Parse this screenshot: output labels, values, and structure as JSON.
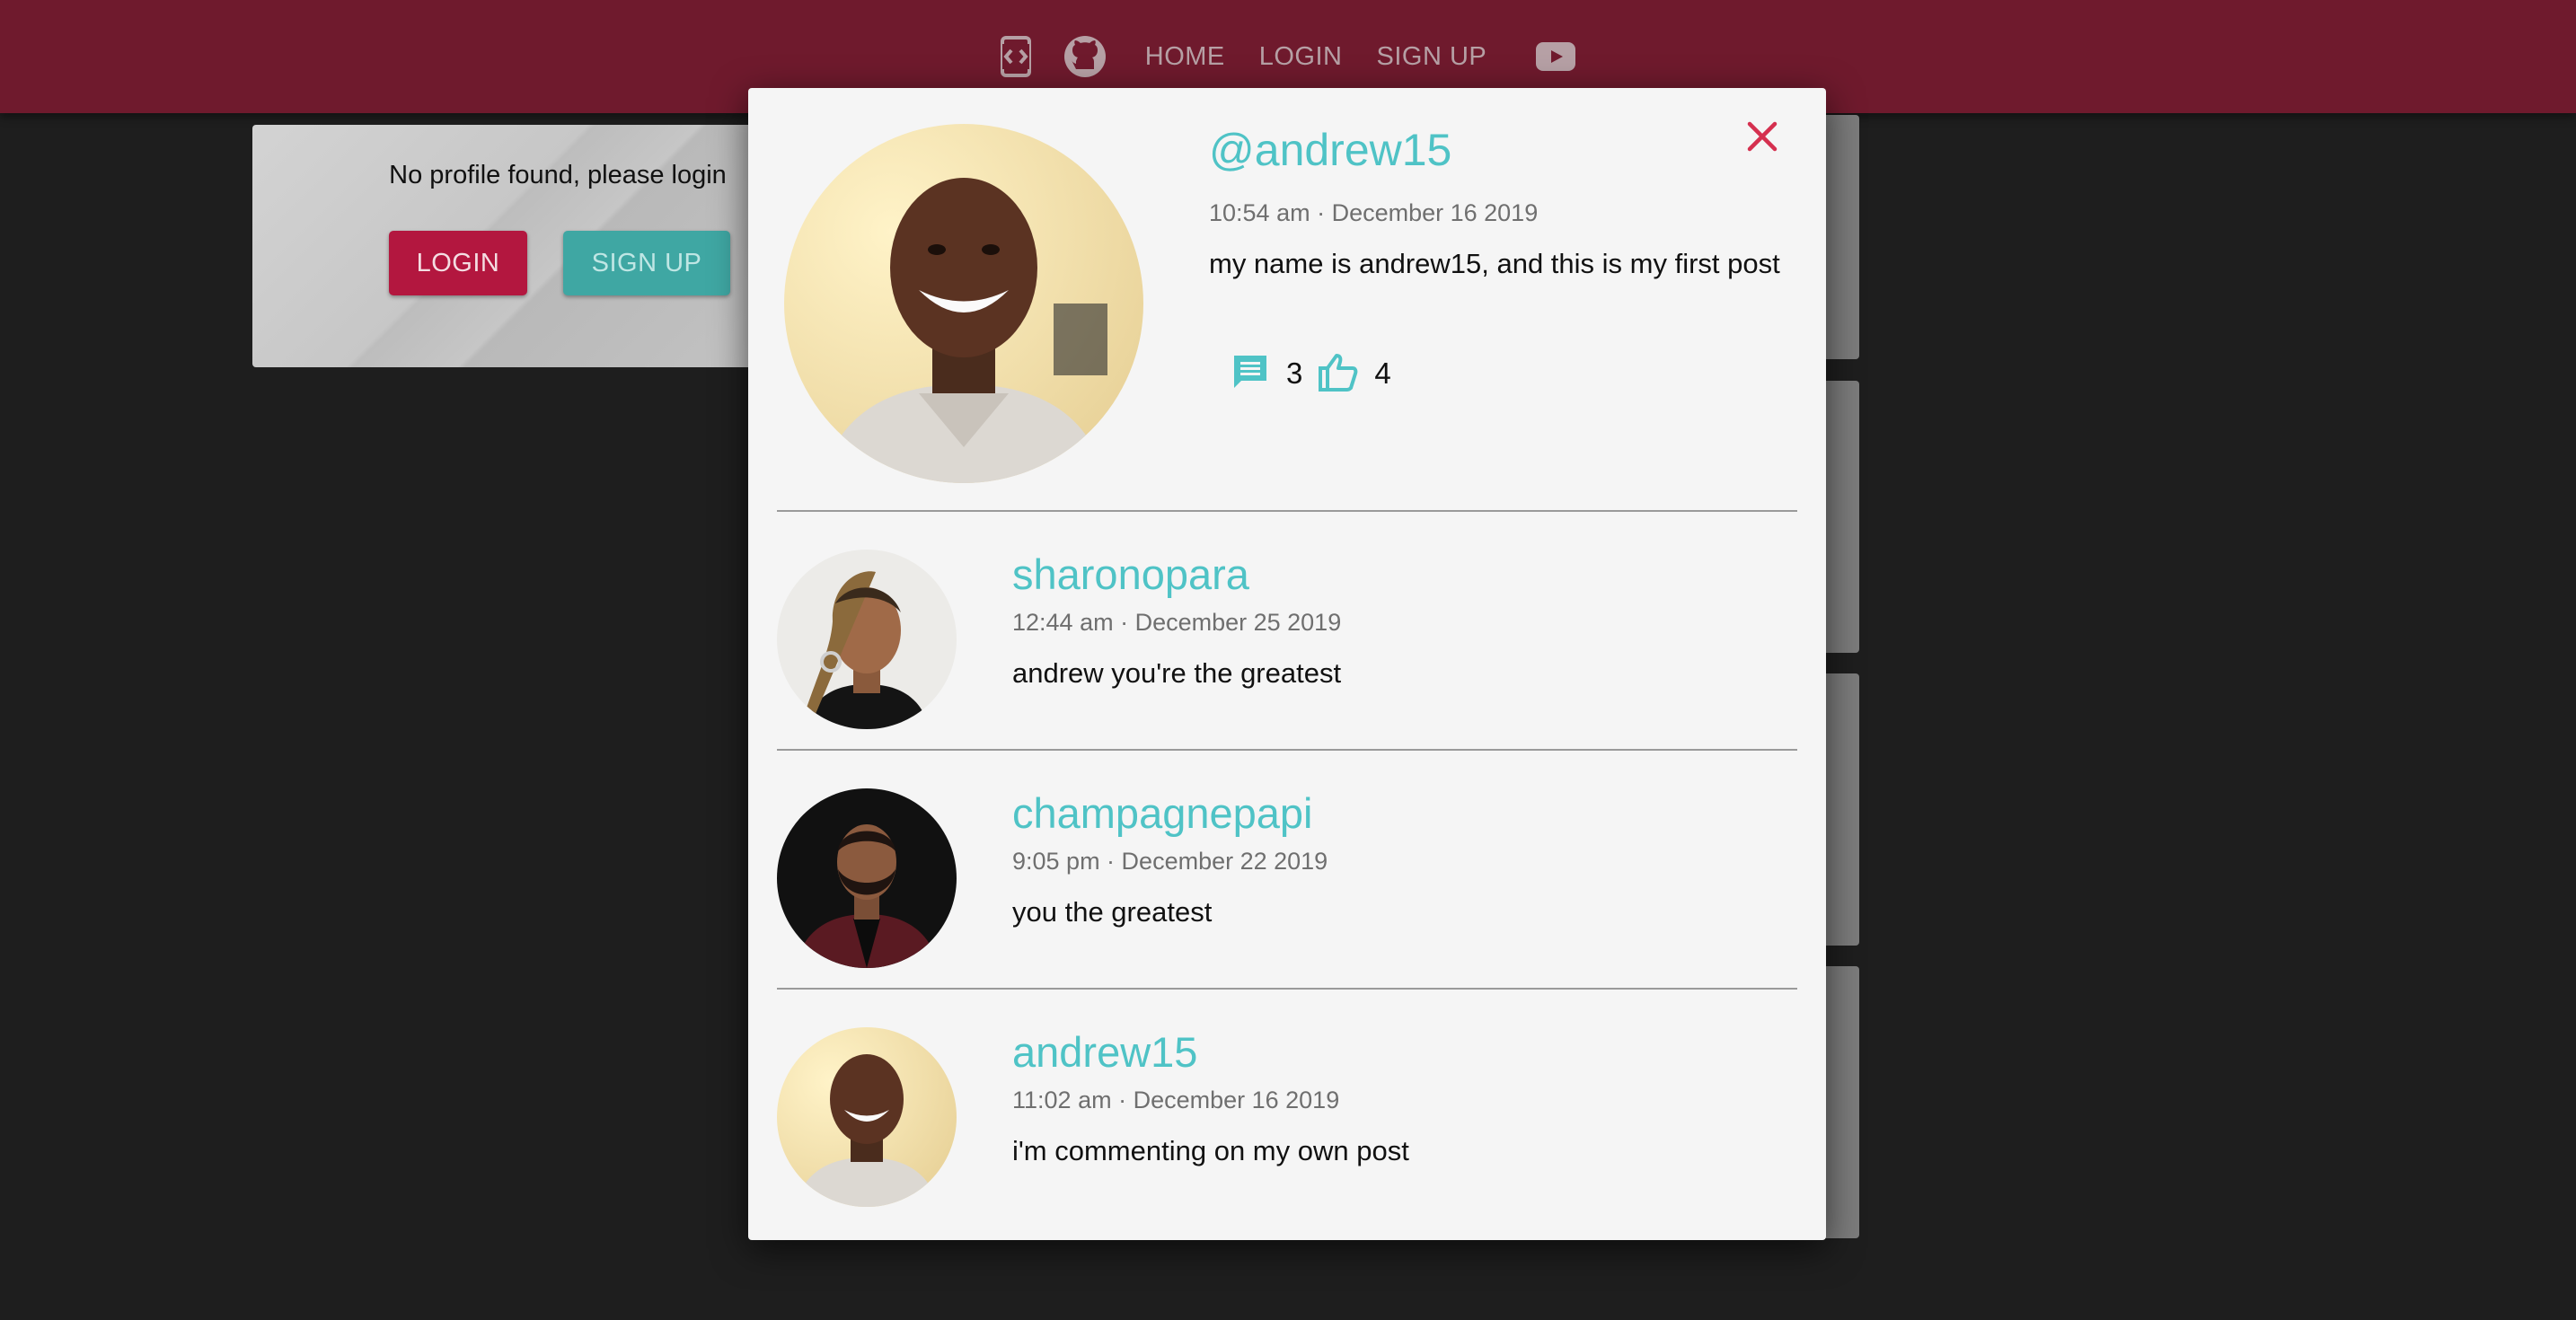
{
  "nav": {
    "home": "HOME",
    "login": "LOGIN",
    "signup": "SIGN UP",
    "icons": [
      "code-icon",
      "github-icon",
      "youtube-icon"
    ]
  },
  "profile_card": {
    "message": "No profile found, please login",
    "login_label": "LOGIN",
    "signup_label": "SIGN UP"
  },
  "post": {
    "handle": "@andrew15",
    "time": "10:54 am · December 16 2019",
    "body": "my name is andrew15, and this is my first post",
    "comment_count": "3",
    "like_count": "4"
  },
  "comments": [
    {
      "user": "sharonopara",
      "time": "12:44 am · December 25 2019",
      "text": "andrew you're the greatest"
    },
    {
      "user": "champagnepapi",
      "time": "9:05 pm · December 22 2019",
      "text": "you the greatest"
    },
    {
      "user": "andrew15",
      "time": "11:02 am · December 16 2019",
      "text": "i'm commenting on my own post"
    }
  ],
  "colors": {
    "appbar": "#6f1a2d",
    "accent_teal": "#4fc3c6",
    "close_red": "#d5304f",
    "login_button": "#b3173f",
    "signup_button": "#3fa7a3"
  }
}
